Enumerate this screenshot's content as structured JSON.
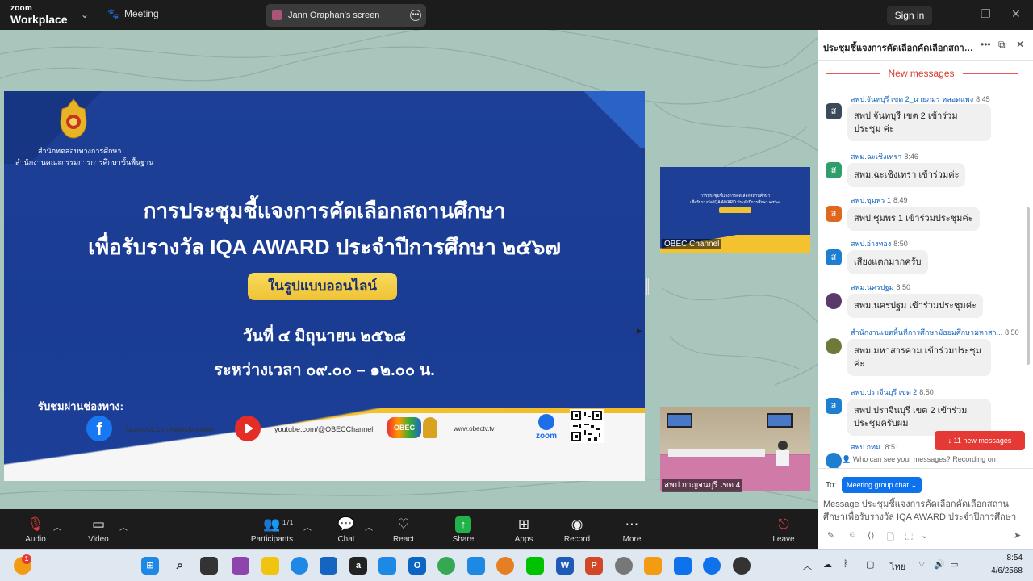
{
  "titlebar": {
    "logo_line1": "zoom",
    "logo_line2": "Workplace",
    "meeting_label": "Meeting",
    "share_label": "Jann Oraphan's screen",
    "signin_label": "Sign in"
  },
  "slide": {
    "org_line1": "สำนักทดสอบทางการศึกษา",
    "org_line2": "สำนักงานคณะกรรมการการศึกษาขั้นพื้นฐาน",
    "title_line1": "การประชุมชี้แจงการคัดเลือกสถานศึกษา",
    "title_line2": "เพื่อรับรางวัล IQA AWARD ประจำปีการศึกษา ๒๕๖๗",
    "badge": "ในรูปแบบออนไลน์",
    "date": "วันที่ ๔ มิถุนายน ๒๕๖๘",
    "time": "ระหว่างเวลา ๐๙.๐๐ – ๑๒.๐๐ น.",
    "watch_label": "รับชมผ่านช่องทาง:",
    "facebook": "facebook.com/obectvonline",
    "youtube": "youtube.com/@OBECChannel",
    "obec_logo": "OBEC",
    "obectv": "www.obectv.tv",
    "zoom_logo": "zoom"
  },
  "thumbnails": {
    "thumb1_label": "OBEC Channel",
    "thumb2_label": "สพป.กาญจนบุรี เขต 4"
  },
  "chat": {
    "title": "ประชุมชี้แจงการคัดเลือกคัดเลือกสถานศึกษา",
    "new_messages_label": "New messages",
    "messages": [
      {
        "avatar": "ส",
        "color": "#3a4a5a",
        "sender": "สพป.จันทบุรี เขต 2_นายภมร หลอดแพง",
        "time": "8:45",
        "text": "สพป จันทบุรี เขต 2 เข้าร่วมประชุม ค่ะ"
      },
      {
        "avatar": "ส",
        "color": "#2e9e6a",
        "sender": "สพม.ฉะเชิงเทรา",
        "time": "8:46",
        "text": "สพม.ฉะเชิงเทรา เข้าร่วมค่ะ"
      },
      {
        "avatar": "ส",
        "color": "#e0681e",
        "sender": "สพป.ชุมพร 1",
        "time": "8:49",
        "text": "สพป.ชุมพร 1 เข้าร่วมประชุมค่ะ"
      },
      {
        "avatar": "ส",
        "color": "#1e7fd0",
        "sender": "สพป.อ่างทอง",
        "time": "8:50",
        "text": "เสียงแตกมากครับ"
      },
      {
        "avatar": "",
        "color": "#5a3a6a",
        "sender": "สพม.นครปฐม",
        "time": "8:50",
        "text": "สพม.นครปฐม เข้าร่วมประชุมค่ะ"
      },
      {
        "avatar": "",
        "color": "#6e7a3a",
        "sender": "สำนักงานเขตพื้นที่การศึกษามัธยมศึกษามหาสา...",
        "time": "8:50",
        "text": "สพม.มหาสารคาม เข้าร่วมประชุม ค่ะ"
      },
      {
        "avatar": "ส",
        "color": "#1e7fd0",
        "sender": "สพป.ปราจีนบุรี เขต 2",
        "time": "8:50",
        "text": "สพป.ปราจีนบุรี เขต 2 เข้าร่วม ประชุมครับผม"
      },
      {
        "avatar": "",
        "color": "#1e7fd0",
        "sender": "สพป.กทม.",
        "time": "8:51",
        "text": ""
      }
    ],
    "new_msgs_button": "↓  11 new messages",
    "who_can_see": "Who can see your messages? Recording on",
    "to_label": "To:",
    "to_value": "Meeting group chat",
    "input_text": "Message ประชุมชี้แจงการคัดเลือกคัดเลือกสถานศึกษาเพื่อรับรางวัล IQA AWARD ประจำปีการศึกษา"
  },
  "toolbar": {
    "audio": "Audio",
    "video": "Video",
    "participants": "Participants",
    "participants_count": "171",
    "chat": "Chat",
    "react": "React",
    "share": "Share",
    "apps": "Apps",
    "record": "Record",
    "more": "More",
    "leave": "Leave"
  },
  "taskbar": {
    "lang": "ไทย",
    "time": "8:54",
    "date": "4/6/2568",
    "notif_badge": "1"
  },
  "colors": {
    "accent": "#0e72ed",
    "slide_blue": "#1d3f96",
    "slide_yellow": "#f4c22e",
    "alert_red": "#e53935",
    "meeting_bg": "#a9c6bd"
  }
}
